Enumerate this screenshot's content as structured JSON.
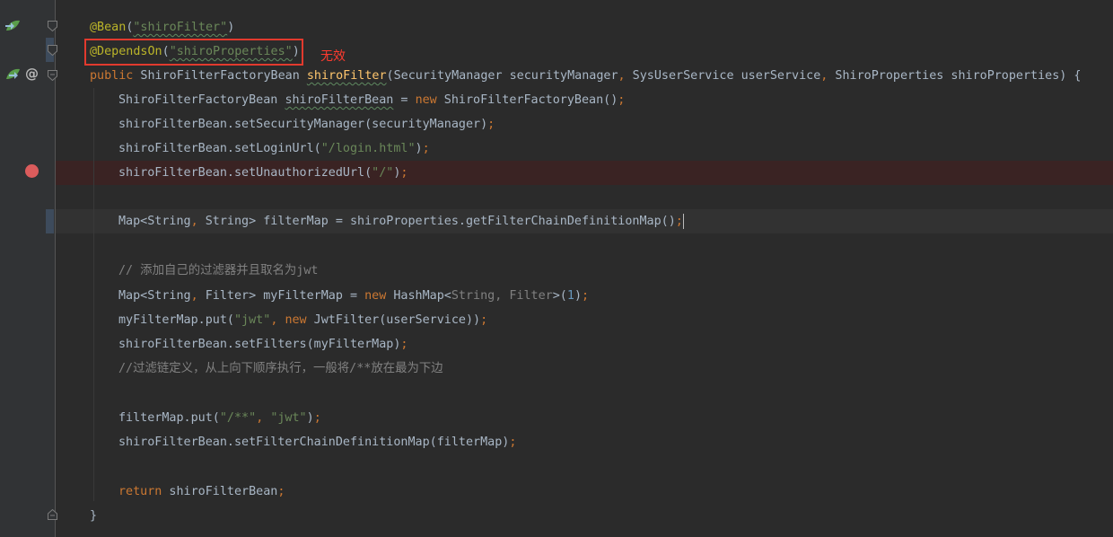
{
  "annotation_note": "无效",
  "code": {
    "l1_ann": "@Bean",
    "l1_p1": "(",
    "l1_str": "\"shiroFilter\"",
    "l1_p2": ")",
    "l2_ann": "@DependsOn",
    "l2_p1": "(",
    "l2_str": "\"shiroProperties\"",
    "l2_p2": ")",
    "l3_kw": "public",
    "l3_type": " ShiroFilterFactoryBean ",
    "l3_fn": "shiroFilter",
    "l3_params1": "(SecurityManager securityManager",
    "l3_c1": ",",
    "l3_params2": " SysUserService userService",
    "l3_c2": ",",
    "l3_params3": " ShiroProperties shiroProperties) {",
    "l4_a": "ShiroFilterFactoryBean ",
    "l4_var": "shiroFilterBean",
    "l4_b": " = ",
    "l4_kw": "new",
    "l4_c": " ShiroFilterFactoryBean()",
    "l4_semi": ";",
    "l5_a": "shiroFilterBean.setSecurityManager(securityManager)",
    "l5_semi": ";",
    "l6_a": "shiroFilterBean.setLoginUrl(",
    "l6_str": "\"/login.html\"",
    "l6_b": ")",
    "l6_semi": ";",
    "l7_a": "shiroFilterBean.setUnauthorizedUrl(",
    "l7_str": "\"/\"",
    "l7_b": ")",
    "l7_semi": ";",
    "l9_a": "Map<String",
    "l9_c1": ",",
    "l9_b": " String> filterMap = shiroProperties.getFilterChainDefinitionMap()",
    "l9_semi": ";",
    "l11_cmt": "// 添加自己的过滤器并且取名为jwt",
    "l12_a": "Map<String",
    "l12_c1": ",",
    "l12_b": " Filter> myFilterMap = ",
    "l12_kw": "new",
    "l12_c": " HashMap<",
    "l12_gen": "String, Filter",
    "l12_d": ">(",
    "l12_num": "1",
    "l12_e": ")",
    "l12_semi": ";",
    "l13_a": "myFilterMap.put(",
    "l13_str": "\"jwt\"",
    "l13_c1": ",",
    "l13_sp": " ",
    "l13_kw": "new",
    "l13_b": " JwtFilter(userService))",
    "l13_semi": ";",
    "l14_a": "shiroFilterBean.setFilters(myFilterMap)",
    "l14_semi": ";",
    "l15_cmt": "//过滤链定义，从上向下顺序执行，一般将/**放在最为下边",
    "l17_a": "filterMap.put(",
    "l17_str1": "\"/**\"",
    "l17_c1": ",",
    "l17_sp": " ",
    "l17_str2": "\"jwt\"",
    "l17_b": ")",
    "l17_semi": ";",
    "l18_a": "shiroFilterBean.setFilterChainDefinitionMap(filterMap)",
    "l18_semi": ";",
    "l20_kw": "return",
    "l20_a": " shiroFilterBean",
    "l20_semi": ";",
    "l21_a": "}"
  },
  "colors": {
    "background": "#2b2b2b",
    "keyword": "#cc7832",
    "string": "#6a8759",
    "annotation": "#bbb529",
    "function": "#ffc66d",
    "comment": "#808080",
    "highlight_box": "#e23a2e",
    "breakpoint": "#db5c5c"
  },
  "icons": {
    "bean_icons": "spring-bean-icon",
    "override": "at-sign-icon",
    "breakpoint": "breakpoint-icon",
    "fold": "fold-marker-icon"
  }
}
